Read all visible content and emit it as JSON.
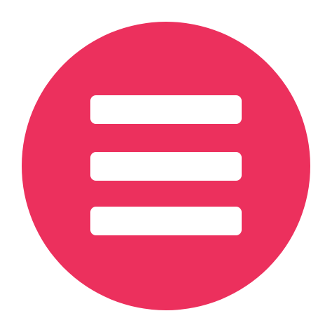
{
  "icon": {
    "name": "hamburger-menu-icon",
    "circle_color": "#EC305D",
    "bar_color": "#FFFFFF",
    "background_color": "#FFFFFF",
    "bar_count": 3
  }
}
